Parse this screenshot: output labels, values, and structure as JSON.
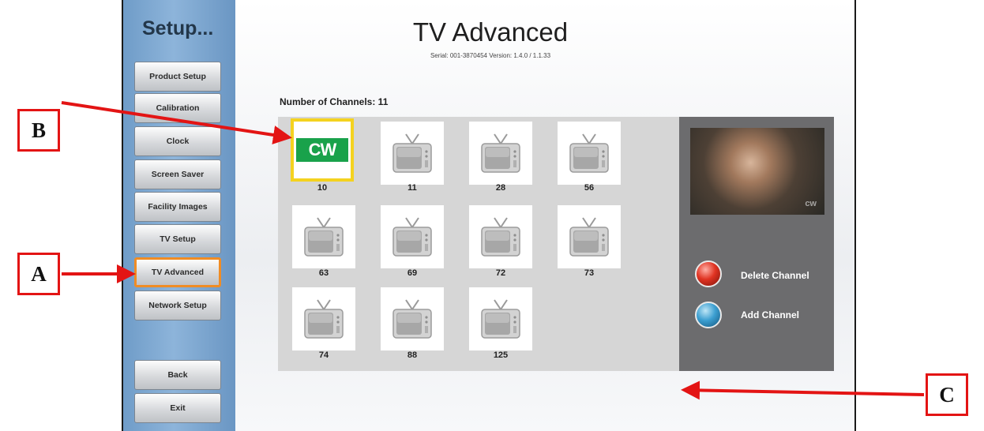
{
  "window": {
    "page_title": "TV Advanced",
    "subtitle": "Serial: 001-3870454   Version: 1.4.0 / 1.1.33"
  },
  "sidebar": {
    "title": "Setup...",
    "items": [
      {
        "label": "Product Setup"
      },
      {
        "label": "Calibration"
      },
      {
        "label": "Clock"
      },
      {
        "label": "Screen Saver"
      },
      {
        "label": "Facility Images"
      },
      {
        "label": "TV Setup"
      },
      {
        "label": "TV Advanced",
        "active": true
      },
      {
        "label": "Network Setup"
      }
    ],
    "bottom": [
      {
        "label": "Back"
      },
      {
        "label": "Exit"
      }
    ]
  },
  "channels": {
    "count_label": "Number of Channels: 11",
    "items": [
      {
        "number": "10",
        "logo": "CW",
        "selected": true
      },
      {
        "number": "11",
        "icon": "tv-icon"
      },
      {
        "number": "28",
        "icon": "tv-icon"
      },
      {
        "number": "56",
        "icon": "tv-icon"
      },
      {
        "number": "63",
        "icon": "tv-icon"
      },
      {
        "number": "69",
        "icon": "tv-icon"
      },
      {
        "number": "72",
        "icon": "tv-icon"
      },
      {
        "number": "73",
        "icon": "tv-icon"
      },
      {
        "number": "74",
        "icon": "tv-icon"
      },
      {
        "number": "88",
        "icon": "tv-icon"
      },
      {
        "number": "125",
        "icon": "tv-icon"
      }
    ]
  },
  "preview": {
    "watermark": "cw"
  },
  "actions": {
    "delete_label": "Delete Channel",
    "add_label": "Add Channel"
  },
  "callouts": {
    "a": "A",
    "b": "B",
    "c": "C"
  },
  "colors": {
    "sidebar": "#7aa6d1",
    "active_border": "#f08c24",
    "selected_border": "#f4d21f",
    "cw_green": "#19a24b",
    "panel_dark": "#6c6c6e",
    "callout_red": "#e31414",
    "delete_button": "#e03322",
    "add_button": "#3c9fd1"
  }
}
